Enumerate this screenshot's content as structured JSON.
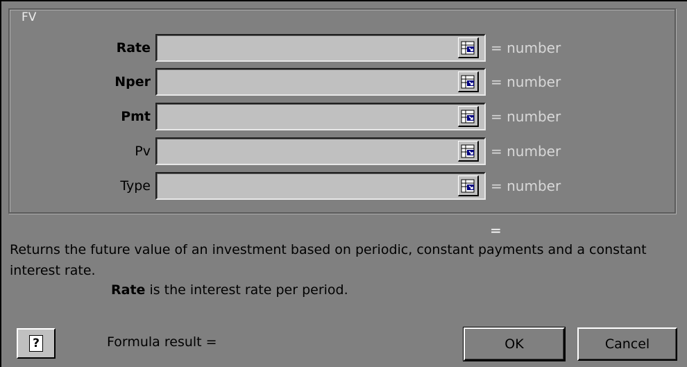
{
  "dialog": {
    "group_title": "FV",
    "arguments": [
      {
        "label": "Rate",
        "required": true,
        "value": "",
        "result": "= number"
      },
      {
        "label": "Nper",
        "required": true,
        "value": "",
        "result": "= number"
      },
      {
        "label": "Pmt",
        "required": true,
        "value": "",
        "result": "= number"
      },
      {
        "label": "Pv",
        "required": false,
        "value": "",
        "result": "= number"
      },
      {
        "label": "Type",
        "required": false,
        "value": "",
        "result": "= number"
      }
    ],
    "function_result": "=",
    "description": "Returns the future value of an investment based on periodic, constant payments and a constant interest rate.",
    "arg_help_name": "Rate",
    "arg_help_text": " is the interest rate per period.",
    "help_button_glyph": "?",
    "formula_result_label": "Formula result =",
    "ok_label": "OK",
    "cancel_label": "Cancel"
  }
}
